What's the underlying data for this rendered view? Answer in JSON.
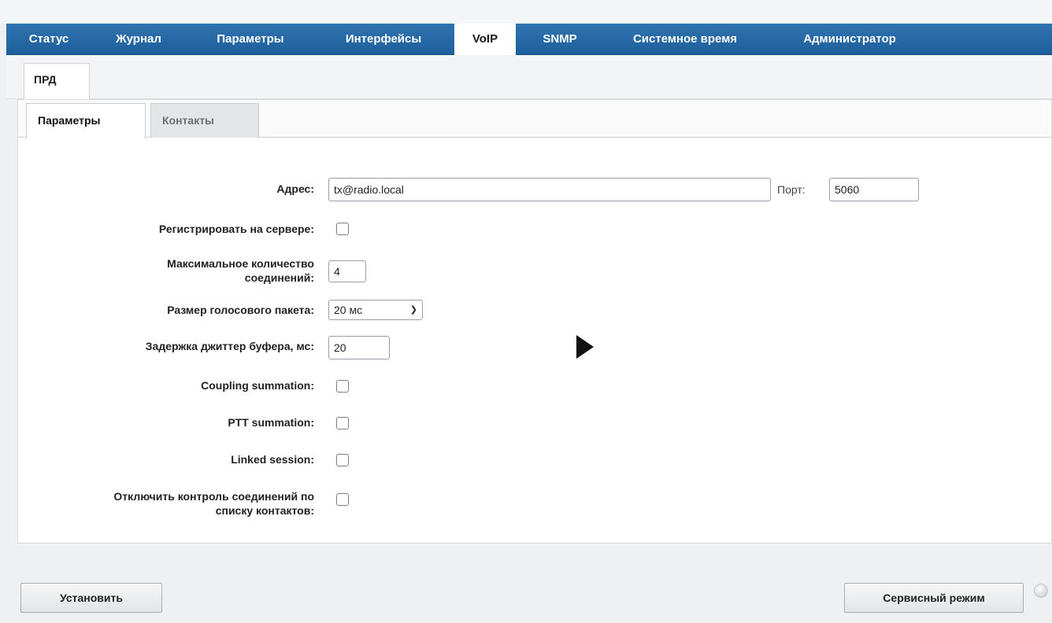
{
  "nav": {
    "tabs": [
      {
        "label": "Статус"
      },
      {
        "label": "Журнал"
      },
      {
        "label": "Параметры"
      },
      {
        "label": "Интерфейсы"
      },
      {
        "label": "VoIP",
        "active": true
      },
      {
        "label": "SNMP"
      },
      {
        "label": "Системное время"
      },
      {
        "label": "Администратор"
      }
    ]
  },
  "subnav": {
    "prd_label": "ПРД"
  },
  "tabs": {
    "params_label": "Параметры",
    "contacts_label": "Контакты"
  },
  "form": {
    "address_label": "Адрес:",
    "address_value": "tx@radio.local",
    "port_label": "Порт:",
    "port_value": "5060",
    "register_label": "Регистрировать на сервере:",
    "max_conn_label_line1": "Максимальное количество",
    "max_conn_label_line2": "соединений:",
    "max_conn_value": "4",
    "packet_size_label": "Размер голосового пакета:",
    "packet_size_value": "20 мс",
    "jitter_label": "Задержка джиттер буфера, мс:",
    "jitter_value": "20",
    "coupling_label": "Coupling summation:",
    "ptt_label": "PTT summation:",
    "linked_label": "Linked session:",
    "disable_ctrl_label_line1": "Отключить контроль соединений по",
    "disable_ctrl_label_line2": "списку контактов:"
  },
  "footer": {
    "apply_label": "Установить",
    "service_label": "Сервисный режим"
  },
  "colors": {
    "nav_blue": "#1d5f9b",
    "panel_bg": "#ffffff",
    "page_bg": "#eef0f1"
  }
}
